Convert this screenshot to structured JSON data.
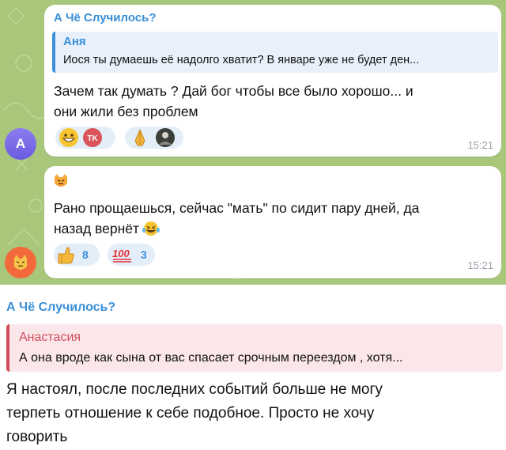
{
  "colors": {
    "accent": "#3a8fd8",
    "quote_pink": "#d14a5a",
    "chat_bg": "#a9c77b"
  },
  "message1": {
    "sender": "А Чё Случилось?",
    "reply": {
      "name": "Аня",
      "text": "Иося ты думаешь её надолго хватит? В январе уже не будет ден..."
    },
    "text_line1": "Зачем так думать ? Дай бог чтобы все было хорошо... и",
    "text_line2": "они жили без проблем",
    "time": "15:21",
    "avatar_letter": "А",
    "reactions": [
      "grinning-emoji",
      "tk-avatar",
      "folded-hands-emoji",
      "user-photo-avatar"
    ]
  },
  "message2": {
    "emoji_icon": "pouting-cat-emoji",
    "text_line1": "Рано прощаешься, сейчас \"мать\" по сидит пару дней, да",
    "text_line2": "назад вернёт",
    "time": "15:21",
    "reactions": [
      {
        "icon": "thumbs-up-emoji",
        "count": "8"
      },
      {
        "icon": "hundred-points-emoji",
        "count": "3"
      }
    ]
  },
  "message3": {
    "sender": "А Чё Случилось?",
    "reply": {
      "name": "Анастасия",
      "text": "А она вроде как сына от вас спасает срочным переездом , хотя..."
    },
    "text_line1": "Я настоял, после последних событий больше не могу",
    "text_line2": "терпеть отношение к себе подобное. Просто не хочу",
    "text_line3": "говорить"
  }
}
